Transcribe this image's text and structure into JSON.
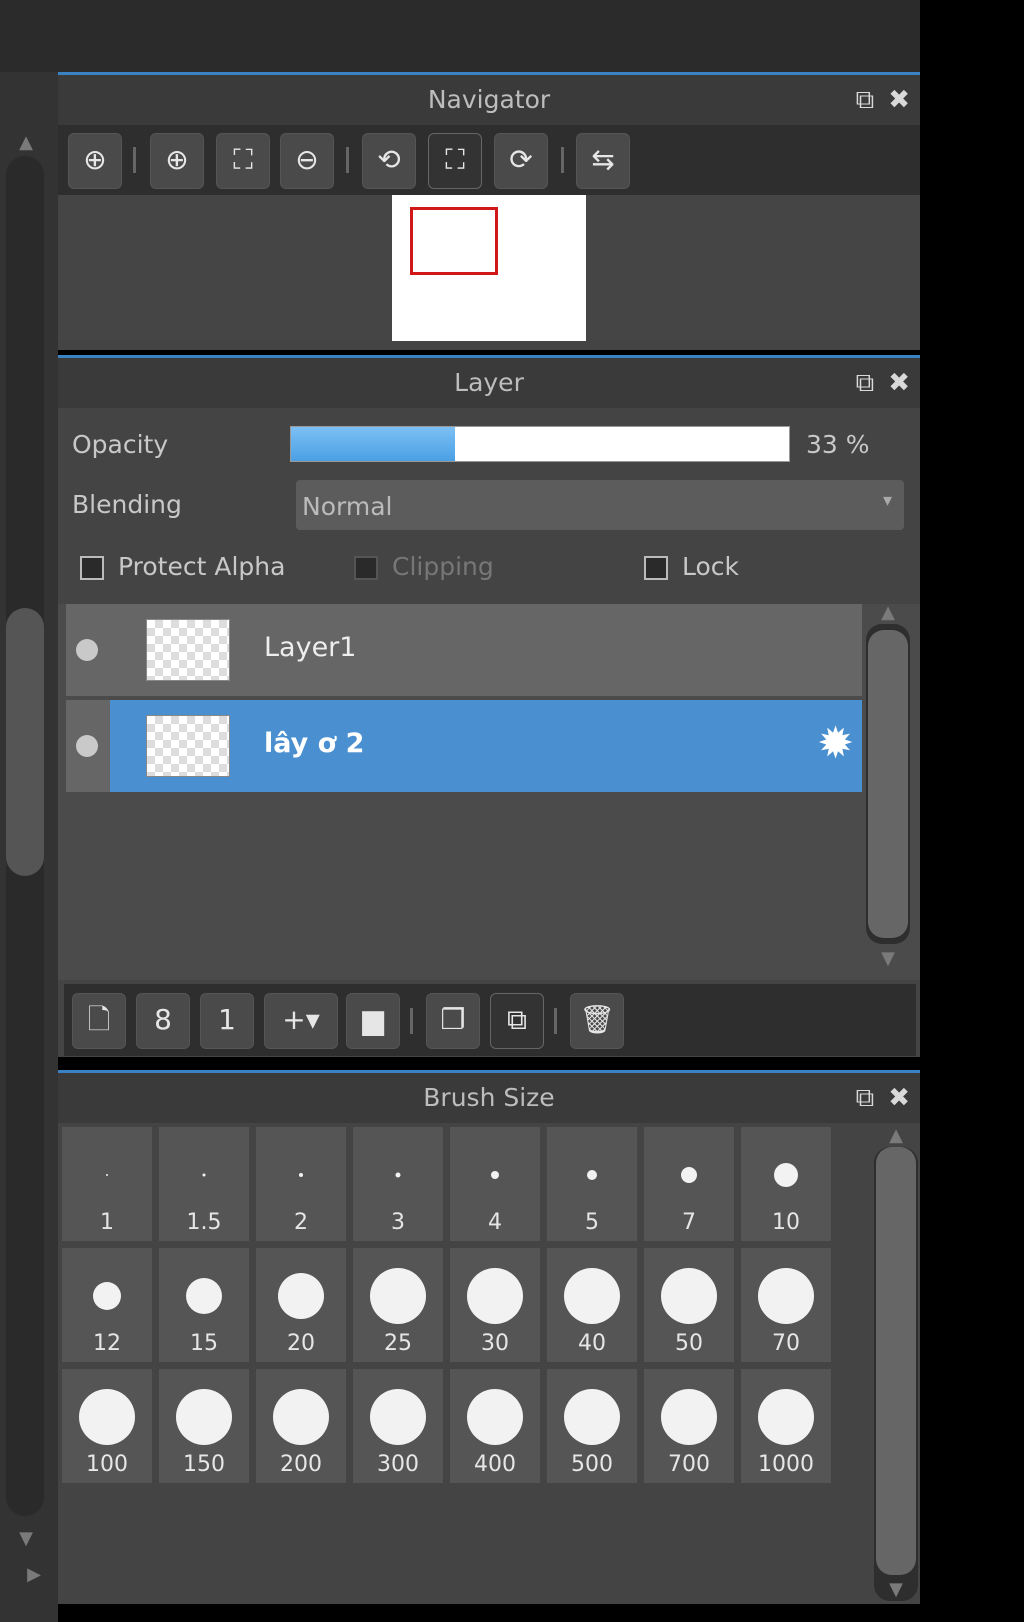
{
  "navigator": {
    "title": "Navigator",
    "tools": [
      "zoom-actual-icon",
      "zoom-in-icon",
      "fit-icon",
      "zoom-out-icon",
      "rotate-left-icon",
      "fullscreen-icon",
      "rotate-right-icon",
      "flip-icon"
    ]
  },
  "layer": {
    "title": "Layer",
    "opacity_label": "Opacity",
    "opacity_value": 0.33,
    "opacity_text": "33 %",
    "blending_label": "Blending",
    "blending_value": "Normal",
    "protect_alpha": "Protect Alpha",
    "clipping": "Clipping",
    "lock": "Lock",
    "items": [
      {
        "name": "Layer1",
        "selected": false
      },
      {
        "name": "lây ơ 2",
        "selected": true
      }
    ]
  },
  "brush": {
    "title": "Brush Size",
    "sizes": [
      "1",
      "1.5",
      "2",
      "3",
      "4",
      "5",
      "7",
      "10",
      "12",
      "15",
      "20",
      "25",
      "30",
      "40",
      "50",
      "70",
      "100",
      "150",
      "200",
      "300",
      "400",
      "500",
      "700",
      "1000"
    ]
  },
  "colors": {
    "accent": "#3b82c4",
    "selected_row": "#4a90d0",
    "opacity_fill": "#5aaeea"
  }
}
